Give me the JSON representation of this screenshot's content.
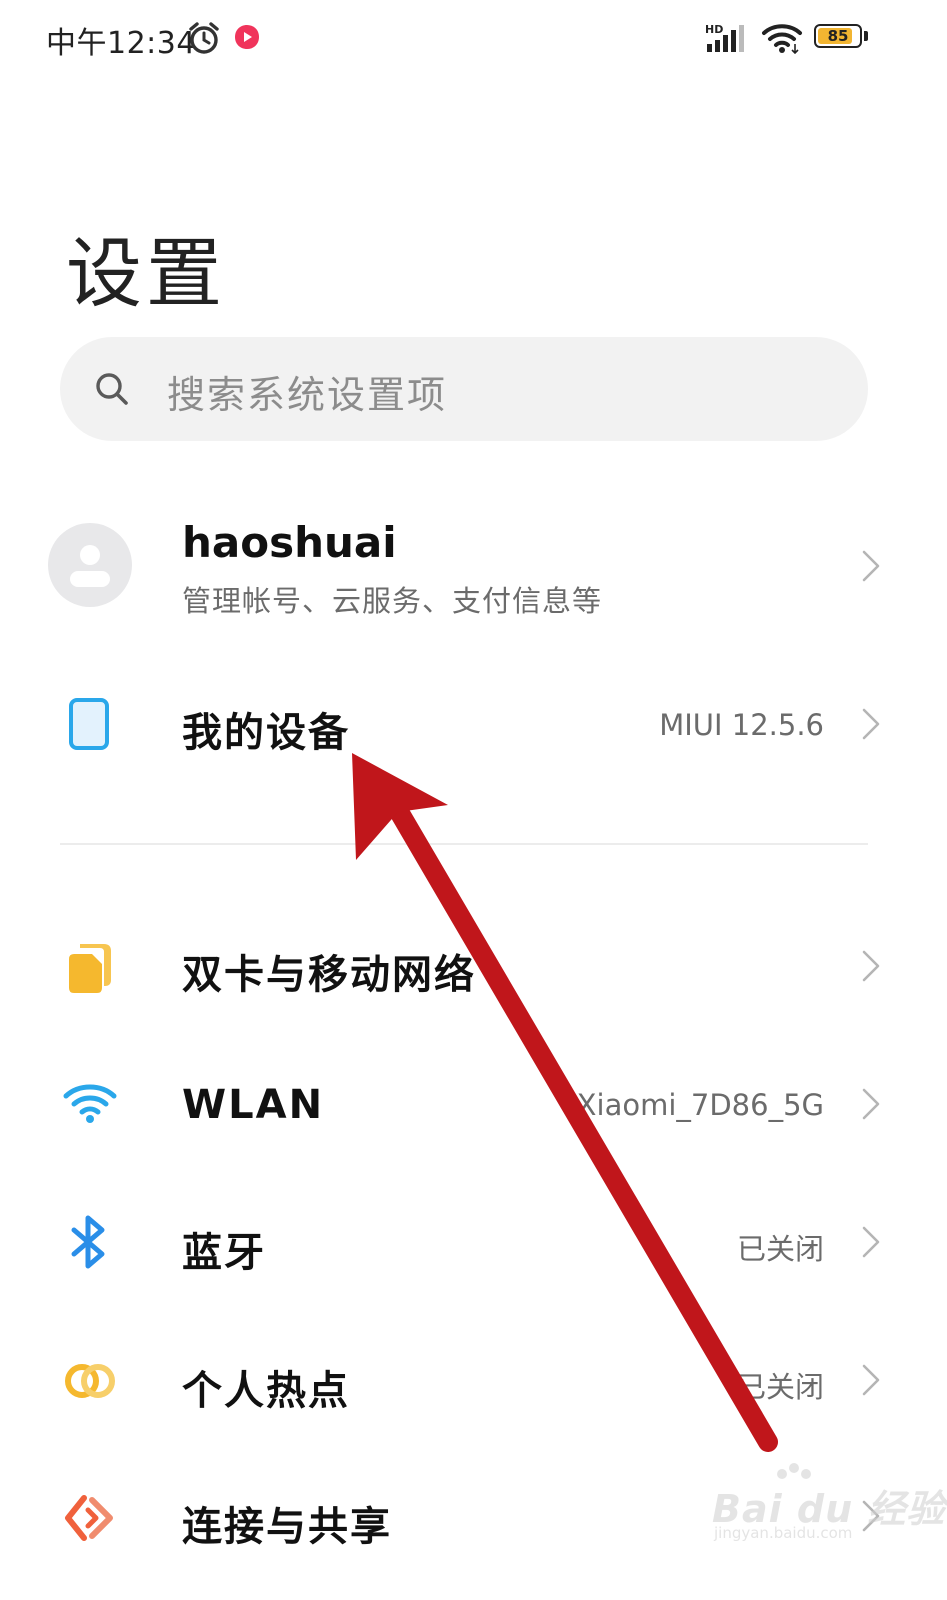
{
  "status_bar": {
    "time": "中午12:34",
    "network_label": "HD",
    "battery_level": "85",
    "battery_fraction": 0.85,
    "icons": [
      "alarm-icon",
      "app-notification-icon",
      "signal-icon",
      "wifi-icon",
      "battery-icon"
    ]
  },
  "page": {
    "title": "设置"
  },
  "search": {
    "placeholder": "搜索系统设置项"
  },
  "account": {
    "name": "haoshuai",
    "subtitle": "管理帐号、云服务、支付信息等"
  },
  "my_device": {
    "label": "我的设备",
    "value": "MIUI 12.5.6"
  },
  "settings": [
    {
      "label": "双卡与移动网络",
      "value": "",
      "icon": "sim-card-icon",
      "color": "#f5b82e"
    },
    {
      "label": "WLAN",
      "value": "Xiaomi_7D86_5G",
      "icon": "wifi-icon",
      "color": "#2aa7ea"
    },
    {
      "label": "蓝牙",
      "value": "已关闭",
      "icon": "bluetooth-icon",
      "color": "#2a8ee8"
    },
    {
      "label": "个人热点",
      "value": "已关闭",
      "icon": "hotspot-icon",
      "color": "#f5b82e"
    },
    {
      "label": "连接与共享",
      "value": "",
      "icon": "connection-sharing-icon",
      "color": "#f0613c"
    }
  ],
  "annotation": {
    "arrow_color": "#c0161b"
  },
  "watermark": {
    "main": "Bai du 经验",
    "sub": "jingyan.baidu.com"
  }
}
